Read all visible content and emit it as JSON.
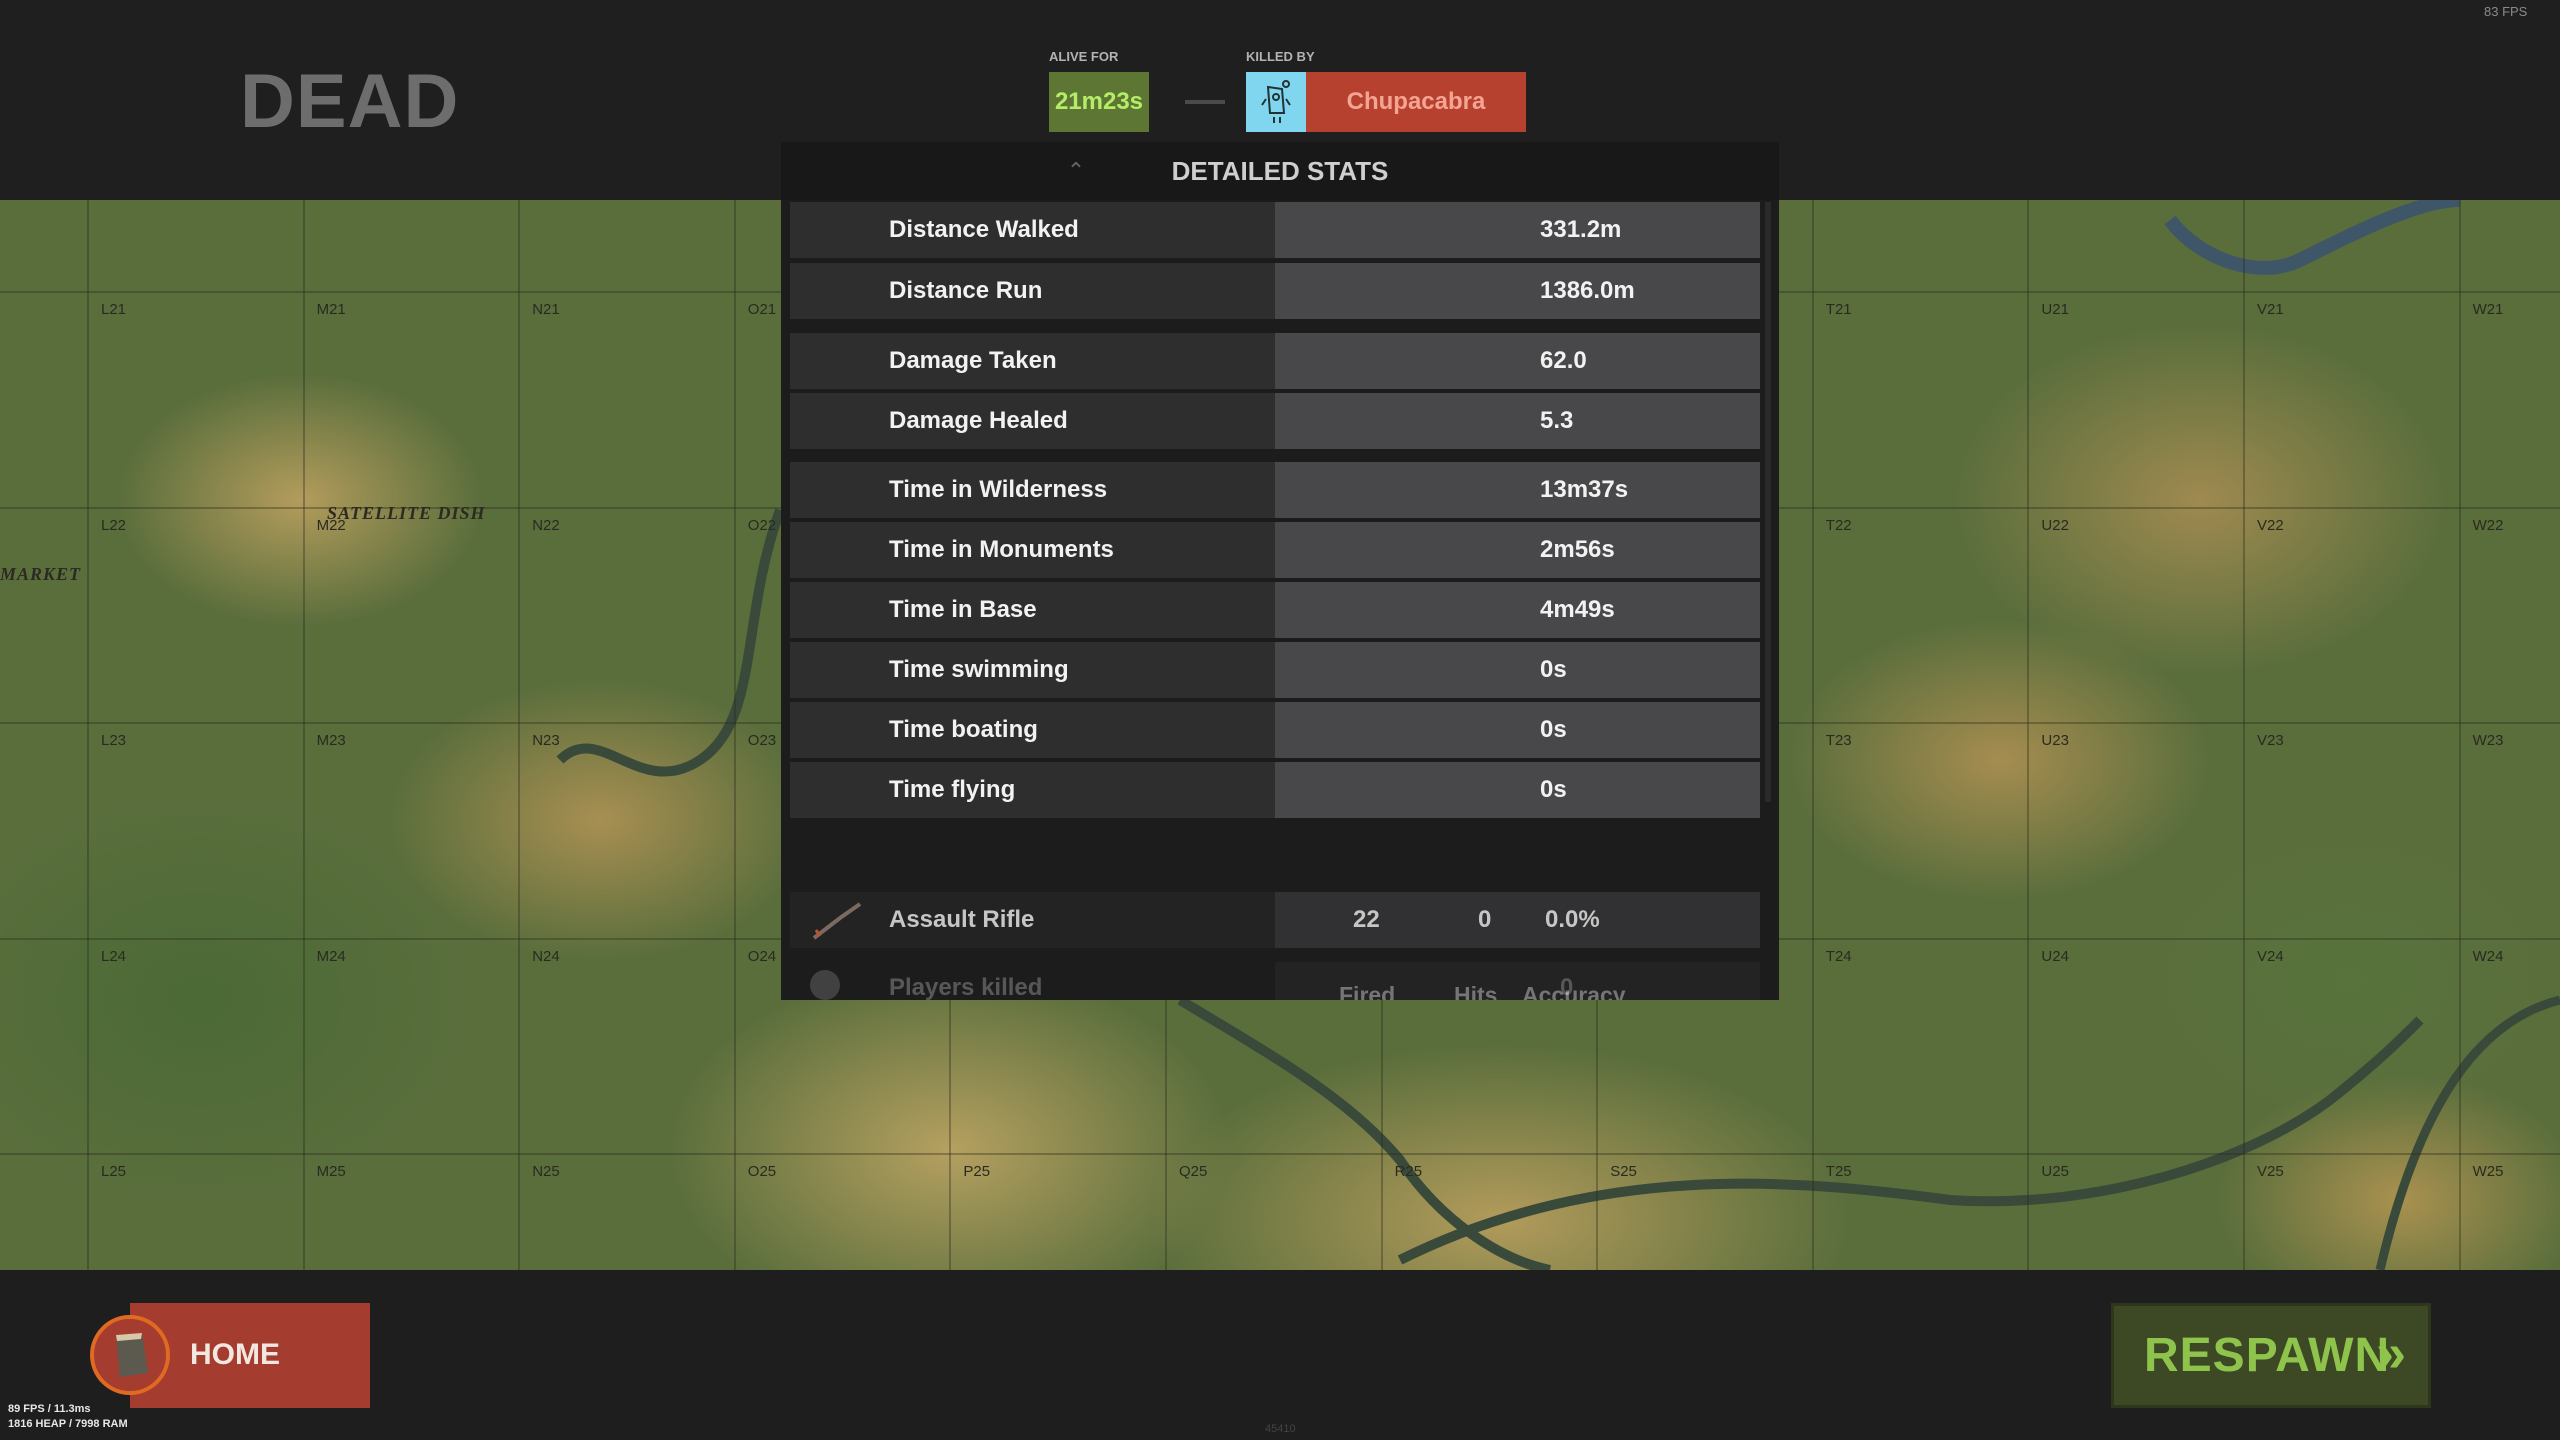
{
  "header": {
    "title": "DEAD",
    "alive_for_label": "ALIVE FOR",
    "alive_for_value": "21m23s",
    "killed_by_label": "KILLED BY",
    "killer_name": "Chupacabra",
    "killer_icon": "scientist-npc-icon"
  },
  "panel": {
    "title": "DETAILED STATS",
    "collapse_icon": "chevron-up-icon",
    "stats": [
      {
        "label": "Distance Walked",
        "value": "331.2m"
      },
      {
        "label": "Distance Run",
        "value": "1386.0m"
      },
      {
        "label": "Damage Taken",
        "value": "62.0"
      },
      {
        "label": "Damage Healed",
        "value": "5.3"
      },
      {
        "label": "Time in Wilderness",
        "value": "13m37s"
      },
      {
        "label": "Time in Monuments",
        "value": "2m56s"
      },
      {
        "label": "Time in Base",
        "value": "4m49s"
      },
      {
        "label": "Time swimming",
        "value": "0s"
      },
      {
        "label": "Time boating",
        "value": "0s"
      },
      {
        "label": "Time flying",
        "value": "0s"
      }
    ],
    "weapon_headers": {
      "fired": "Fired",
      "hits": "Hits",
      "accuracy": "Accuracy"
    },
    "weapons": [
      {
        "name": "Assault Rifle",
        "fired": "22",
        "hits": "0",
        "accuracy": "0.0%"
      }
    ],
    "partial_row": {
      "label": "Players killed",
      "value": "0"
    }
  },
  "map": {
    "columns": [
      "L",
      "M",
      "N",
      "O",
      "P",
      "Q",
      "R",
      "S",
      "T",
      "U",
      "V",
      "W"
    ],
    "rows": [
      "21",
      "22",
      "23",
      "24",
      "25"
    ],
    "places": [
      {
        "name": "SATELLITE DISH"
      },
      {
        "name": "MARKET"
      }
    ]
  },
  "footer": {
    "home_label": "HOME",
    "respawn_label": "RESPAWN",
    "respawn_icon": "double-chevron-right-icon"
  },
  "debug": {
    "fps_line": "89 FPS / 11.3ms",
    "mem_line": "1816 HEAP / 7998 RAM",
    "fps_corner": "83 FPS",
    "build": "45410"
  },
  "colors": {
    "alive": "#5d7634",
    "killer": "#b6412f",
    "killer_icon_bg": "#80d6ee",
    "home": "#a43d2f",
    "respawn": "#3d4825",
    "respawn_text": "#8fc44c"
  }
}
